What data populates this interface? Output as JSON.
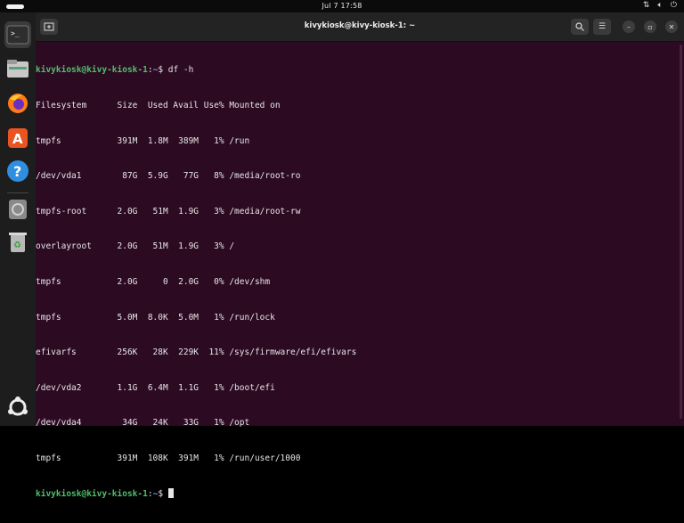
{
  "topbar": {
    "clock": "Jul 7  17:58",
    "tray_icons": [
      "network-icon",
      "volume-icon",
      "power-icon"
    ]
  },
  "dock": {
    "items": [
      {
        "name": "terminal",
        "active": true
      },
      {
        "name": "files",
        "active": false
      },
      {
        "name": "firefox",
        "active": false
      },
      {
        "name": "app-center",
        "active": false
      },
      {
        "name": "help",
        "active": false
      },
      {
        "name": "disk",
        "active": false
      },
      {
        "name": "trash",
        "active": false
      }
    ],
    "apps_button": "show-apps"
  },
  "window": {
    "title": "kivykiosk@kivy-kiosk-1: ~"
  },
  "terminal": {
    "prompt_user": "kivykiosk@kivy-kiosk-1",
    "prompt_path": "~",
    "command": "df -h",
    "header": "Filesystem      Size  Used Avail Use% Mounted on",
    "rows": [
      "tmpfs           391M  1.8M  389M   1% /run",
      "/dev/vda1        87G  5.9G   77G   8% /media/root-ro",
      "tmpfs-root      2.0G   51M  1.9G   3% /media/root-rw",
      "overlayroot     2.0G   51M  1.9G   3% /",
      "tmpfs           2.0G     0  2.0G   0% /dev/shm",
      "tmpfs           5.0M  8.0K  5.0M   1% /run/lock",
      "efivarfs        256K   28K  229K  11% /sys/firmware/efi/efivars",
      "/dev/vda2       1.1G  6.4M  1.1G   1% /boot/efi",
      "/dev/vda4        34G   24K   33G   1% /opt",
      "tmpfs           391M  108K  391M   1% /run/user/1000"
    ]
  }
}
